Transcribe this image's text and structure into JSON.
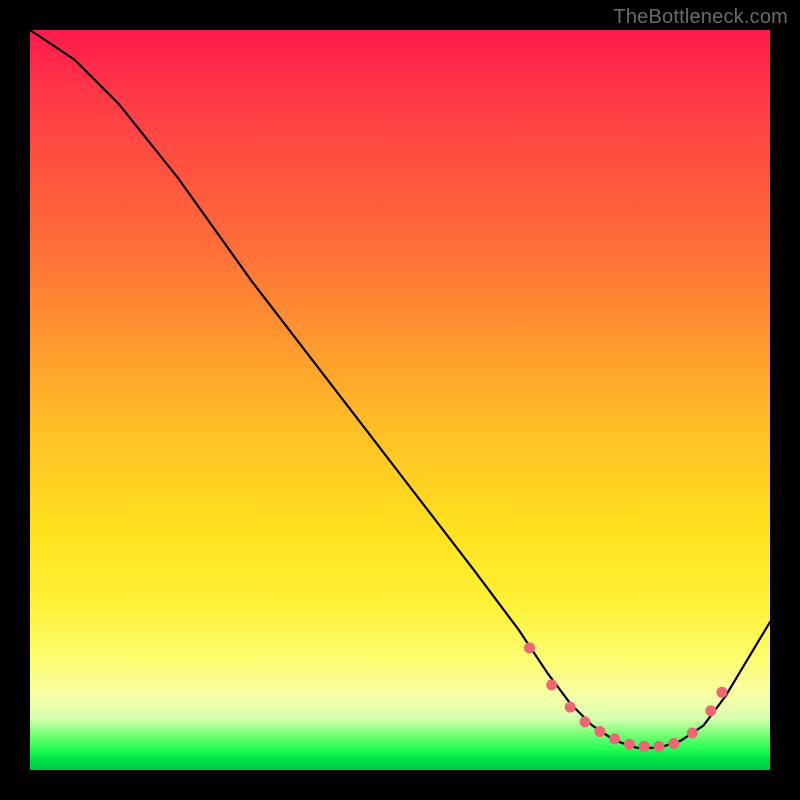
{
  "watermark": "TheBottleneck.com",
  "colors": {
    "dot": "#ee6673",
    "line": "#000000"
  },
  "chart_data": {
    "type": "line",
    "title": "",
    "xlabel": "",
    "ylabel": "",
    "xlim": [
      0,
      100
    ],
    "ylim": [
      0,
      100
    ],
    "series": [
      {
        "name": "curve",
        "x": [
          0,
          6,
          12,
          20,
          30,
          40,
          50,
          60,
          66,
          70,
          73,
          76,
          79,
          82,
          85,
          88,
          91,
          94,
          100
        ],
        "y": [
          100,
          96,
          90,
          80,
          66,
          53,
          40,
          27,
          19,
          13,
          9,
          6,
          4,
          3,
          3,
          4,
          6,
          10,
          20
        ]
      }
    ],
    "markers": {
      "name": "dots",
      "x": [
        67.5,
        70.5,
        73,
        75,
        77,
        79,
        81,
        83,
        85,
        87,
        89.5,
        92,
        93.5
      ],
      "y": [
        16.5,
        11.5,
        8.5,
        6.5,
        5.2,
        4.2,
        3.5,
        3.2,
        3.2,
        3.6,
        5.0,
        8.0,
        10.5
      ]
    }
  }
}
